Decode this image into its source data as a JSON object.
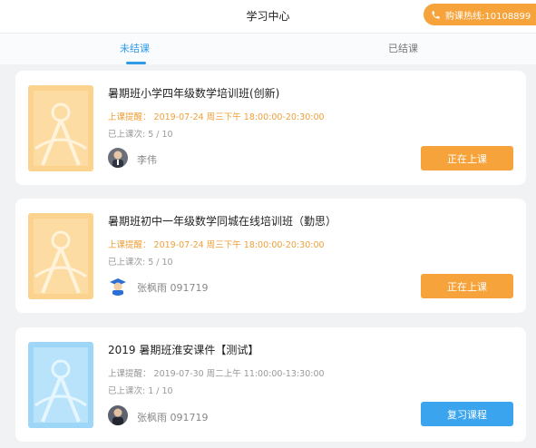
{
  "header": {
    "title": "学习中心",
    "hotline": "购课热线:10108899"
  },
  "tabs": [
    {
      "label": "未结课",
      "active": true
    },
    {
      "label": "已结课",
      "active": false
    }
  ],
  "courses": [
    {
      "title": "暑期班小学四年级数学培训班(创新)",
      "reminder": "上课提醒：  2019-07-24 周三下午 18:00:00-20:30:00",
      "count": "已上课次: 5 / 10",
      "teacher": "李伟",
      "button": "正在上课",
      "theme": "orange"
    },
    {
      "title": "暑期班初中一年级数学同城在线培训班（勤思）",
      "reminder": "上课提醒：  2019-07-24 周三下午 18:00:00-20:30:00",
      "count": "已上课次: 5 / 10",
      "teacher": "张枫雨 091719",
      "button": "正在上课",
      "theme": "orange"
    },
    {
      "title": "2019 暑期班淮安课件【测试】",
      "reminder": "上课提醒：  2019-07-30 周二上午 11:00:00-13:30:00",
      "count": "已上课次: 1 / 10",
      "teacher": "张枫雨 091719",
      "button": "复习课程",
      "theme": "blue"
    }
  ],
  "colors": {
    "accent_blue": "#2f9ae8",
    "accent_orange": "#f5a33a",
    "button_blue": "#3aa4ee"
  },
  "icons": {
    "hotline": "phone-icon",
    "thumb_orange": "compass-illustration",
    "thumb_blue": "compass-illustration",
    "avatar_1": "teacher-photo-avatar",
    "avatar_2": "graduate-cartoon-avatar",
    "avatar_3": "teacher-photo-avatar"
  }
}
